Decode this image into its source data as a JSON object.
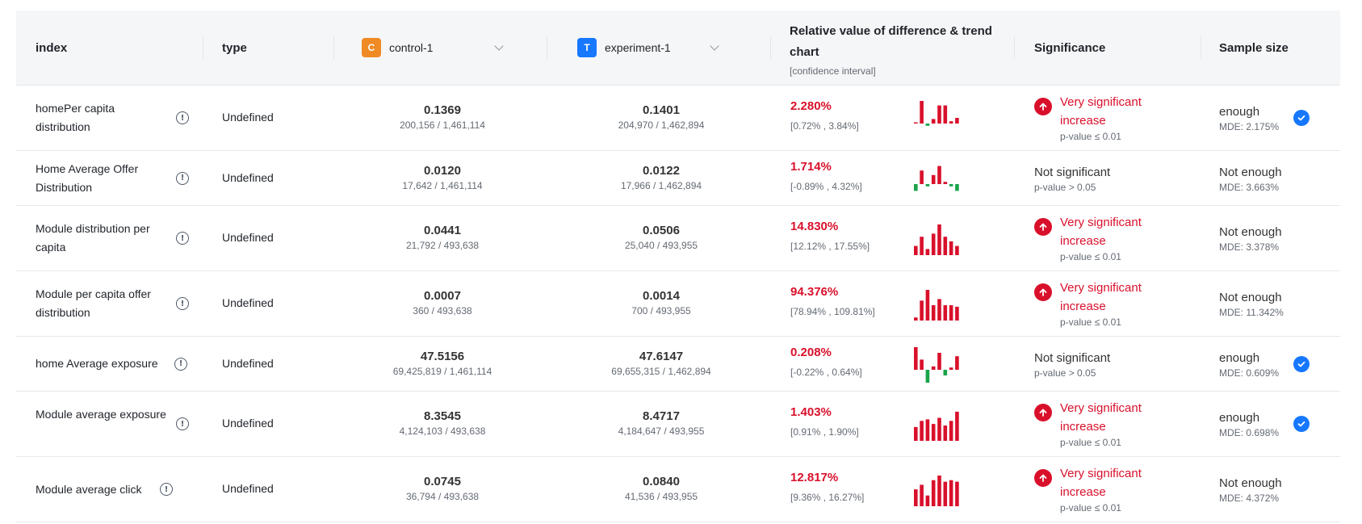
{
  "header": {
    "index": "index",
    "type": "type",
    "control": {
      "badge": "C",
      "name": "control-1",
      "color": "#f08a24"
    },
    "experiment": {
      "badge": "T",
      "name": "experiment-1",
      "color": "#1677ff"
    },
    "relative_title": "Relative value of difference & trend chart",
    "relative_sub": "[confidence interval]",
    "significance": "Significance",
    "sample_size": "Sample size"
  },
  "colors": {
    "positive": "#d9102b",
    "negative": "#1aa34a",
    "check": "#1677ff"
  },
  "rows": [
    {
      "index_label": "homePer capita distribution",
      "type": "Undefined",
      "control_value": "0.1369",
      "control_ratio": "200,156 / 1,461,114",
      "exp_value": "0.1401",
      "exp_ratio": "204,970 / 1,462,894",
      "rel_pct": "2.280%",
      "rel_ci": "[0.72% , 3.84%]",
      "trend": [
        0.05,
        1.0,
        -0.1,
        0.2,
        0.8,
        0.8,
        0.1,
        0.25
      ],
      "sig_text": "Very significant increase",
      "sig_p": "p-value ≤ 0.01",
      "significant": true,
      "sample_status": "enough",
      "mde": "MDE: 2.175%",
      "sample_ok": true
    },
    {
      "index_label": "Home Average Offer Distribution",
      "type": "Undefined",
      "control_value": "0.0120",
      "control_ratio": "17,642 / 1,461,114",
      "exp_value": "0.0122",
      "exp_ratio": "17,966 / 1,462,894",
      "rel_pct": "1.714%",
      "rel_ci": "[-0.89% , 4.32%]",
      "trend": [
        -0.3,
        0.6,
        -0.1,
        0.4,
        0.8,
        0.1,
        -0.1,
        -0.3
      ],
      "sig_text": "Not significant",
      "sig_p": "p-value > 0.05",
      "significant": false,
      "sample_status": "Not enough",
      "mde": "MDE: 3.663%",
      "sample_ok": false
    },
    {
      "index_label": "Module distribution per capita",
      "type": "Undefined",
      "control_value": "0.0441",
      "control_ratio": "21,792 / 493,638",
      "exp_value": "0.0506",
      "exp_ratio": "25,040 / 493,955",
      "rel_pct": "14.830%",
      "rel_ci": "[12.12% , 17.55%]",
      "trend": [
        0.3,
        0.6,
        0.2,
        0.7,
        1.0,
        0.6,
        0.45,
        0.3
      ],
      "sig_text": "Very significant increase",
      "sig_p": "p-value ≤ 0.01",
      "significant": true,
      "sample_status": "Not enough",
      "mde": "MDE: 3.378%",
      "sample_ok": false
    },
    {
      "index_label": "Module per capita offer distribution",
      "type": "Undefined",
      "control_value": "0.0007",
      "control_ratio": "360 / 493,638",
      "exp_value": "0.0014",
      "exp_ratio": "700 / 493,955",
      "rel_pct": "94.376%",
      "rel_ci": "[78.94% , 109.81%]",
      "trend": [
        0.1,
        0.65,
        1.0,
        0.5,
        0.7,
        0.5,
        0.5,
        0.45
      ],
      "sig_text": "Very significant increase",
      "sig_p": "p-value ≤ 0.01",
      "significant": true,
      "sample_status": "Not enough",
      "mde": "MDE: 11.342%",
      "sample_ok": false
    },
    {
      "index_label": "home Average exposure",
      "type": "Undefined",
      "control_value": "47.5156",
      "control_ratio": "69,425,819 / 1,461,114",
      "exp_value": "47.6147",
      "exp_ratio": "69,655,315 / 1,462,894",
      "rel_pct": "0.208%",
      "rel_ci": "[-0.22% , 0.64%]",
      "trend": [
        1.0,
        0.45,
        -0.6,
        0.15,
        0.75,
        -0.25,
        0.1,
        0.6
      ],
      "sig_text": "Not significant",
      "sig_p": "p-value > 0.05",
      "significant": false,
      "sample_status": "enough",
      "mde": "MDE: 0.609%",
      "sample_ok": true
    },
    {
      "index_label": "Module average exposure",
      "type": "Undefined",
      "control_value": "8.3545",
      "control_ratio": "4,124,103 / 493,638",
      "exp_value": "8.4717",
      "exp_ratio": "4,184,647 / 493,955",
      "rel_pct": "1.403%",
      "rel_ci": "[0.91% , 1.90%]",
      "trend": [
        0.45,
        0.65,
        0.7,
        0.55,
        0.75,
        0.5,
        0.65,
        0.95
      ],
      "sig_text": "Very significant increase",
      "sig_p": "p-value ≤ 0.01",
      "significant": true,
      "sample_status": "enough",
      "mde": "MDE: 0.698%",
      "sample_ok": true
    },
    {
      "index_label": "Module average click",
      "type": "Undefined",
      "control_value": "0.0745",
      "control_ratio": "36,794 / 493,638",
      "exp_value": "0.0840",
      "exp_ratio": "41,536 / 493,955",
      "rel_pct": "12.817%",
      "rel_ci": "[9.36% , 16.27%]",
      "trend": [
        0.55,
        0.7,
        0.35,
        0.85,
        1.0,
        0.8,
        0.85,
        0.8
      ],
      "sig_text": "Very significant increase",
      "sig_p": "p-value ≤ 0.01",
      "significant": true,
      "sample_status": "Not enough",
      "mde": "MDE: 4.372%",
      "sample_ok": false
    }
  ]
}
